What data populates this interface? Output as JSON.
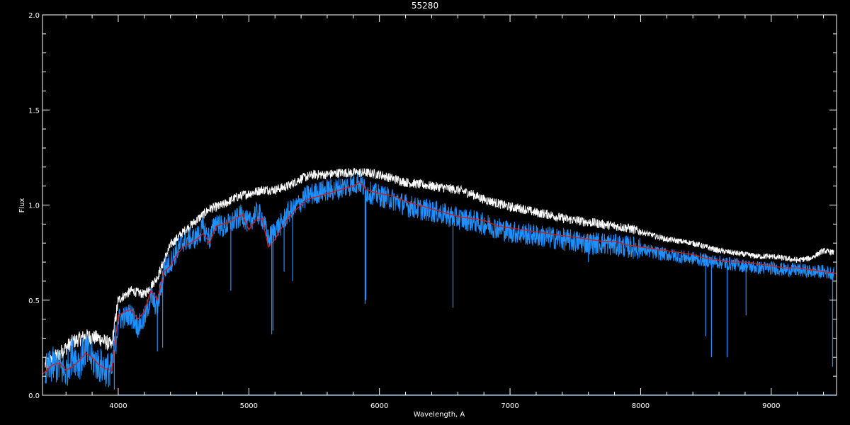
{
  "chart_data": {
    "type": "line",
    "title": "55280",
    "xlabel": "Wavelength, A",
    "ylabel": "Flux",
    "xlim": [
      3420,
      9500
    ],
    "ylim": [
      0.0,
      2.0
    ],
    "x_ticks": [
      4000,
      5000,
      6000,
      7000,
      8000,
      9000
    ],
    "x_tick_labels": [
      "4000",
      "5000",
      "6000",
      "7000",
      "8000",
      "9000"
    ],
    "y_ticks": [
      0.0,
      0.5,
      1.0,
      1.5,
      2.0
    ],
    "y_tick_labels": [
      "0.0",
      "0.5",
      "1.0",
      "1.5",
      "2.0"
    ],
    "background": "#000000",
    "axis_color": "#ffffff",
    "series": [
      {
        "role": "upper-envelope",
        "color": "#ffffff",
        "x": [
          3440,
          3550,
          3650,
          3750,
          3850,
          3950,
          4000,
          4100,
          4200,
          4300,
          4400,
          4500,
          4600,
          4700,
          4800,
          4900,
          5000,
          5100,
          5200,
          5300,
          5400,
          5500,
          5600,
          5700,
          5800,
          5900,
          6000,
          6100,
          6200,
          6300,
          6400,
          6500,
          6600,
          6700,
          6800,
          6900,
          7000,
          7100,
          7200,
          7300,
          7400,
          7500,
          7600,
          7700,
          7800,
          7900,
          8000,
          8100,
          8200,
          8300,
          8400,
          8500,
          8600,
          8700,
          8800,
          8900,
          9000,
          9100,
          9200,
          9300,
          9400,
          9480
        ],
        "y": [
          0.16,
          0.22,
          0.28,
          0.31,
          0.3,
          0.26,
          0.5,
          0.55,
          0.53,
          0.62,
          0.79,
          0.86,
          0.92,
          0.98,
          1.0,
          1.04,
          1.06,
          1.08,
          1.08,
          1.1,
          1.14,
          1.16,
          1.16,
          1.17,
          1.17,
          1.17,
          1.16,
          1.14,
          1.12,
          1.11,
          1.1,
          1.09,
          1.08,
          1.06,
          1.03,
          1.01,
          0.99,
          0.98,
          0.96,
          0.95,
          0.93,
          0.92,
          0.91,
          0.9,
          0.89,
          0.88,
          0.86,
          0.84,
          0.82,
          0.81,
          0.8,
          0.78,
          0.76,
          0.75,
          0.74,
          0.73,
          0.73,
          0.72,
          0.71,
          0.72,
          0.76,
          0.75
        ]
      },
      {
        "role": "observed-spectrum",
        "color": "#1e90ff",
        "x": [
          3440,
          3500,
          3550,
          3600,
          3650,
          3700,
          3750,
          3800,
          3850,
          3900,
          3950,
          4000,
          4050,
          4100,
          4150,
          4200,
          4250,
          4300,
          4350,
          4400,
          4450,
          4500,
          4550,
          4600,
          4650,
          4700,
          4750,
          4800,
          4850,
          4900,
          4950,
          5000,
          5050,
          5100,
          5150,
          5200,
          5250,
          5300,
          5350,
          5400,
          5450,
          5500,
          5550,
          5600,
          5650,
          5700,
          5750,
          5800,
          5850,
          5900,
          5950,
          6000,
          6100,
          6200,
          6300,
          6400,
          6500,
          6600,
          6700,
          6800,
          6900,
          7000,
          7100,
          7200,
          7300,
          7400,
          7500,
          7600,
          7700,
          7800,
          7900,
          8000,
          8100,
          8200,
          8300,
          8400,
          8500,
          8600,
          8700,
          8800,
          8900,
          9000,
          9100,
          9200,
          9300,
          9400,
          9480
        ],
        "y": [
          0.12,
          0.16,
          0.15,
          0.12,
          0.22,
          0.17,
          0.24,
          0.19,
          0.16,
          0.14,
          0.13,
          0.4,
          0.41,
          0.43,
          0.36,
          0.4,
          0.52,
          0.46,
          0.66,
          0.7,
          0.76,
          0.81,
          0.82,
          0.83,
          0.88,
          0.82,
          0.92,
          0.88,
          0.9,
          0.92,
          0.95,
          0.9,
          0.96,
          0.94,
          0.82,
          0.87,
          0.9,
          0.96,
          0.98,
          1.02,
          1.05,
          1.06,
          1.07,
          1.08,
          1.08,
          1.09,
          1.1,
          1.11,
          1.12,
          1.07,
          1.06,
          1.05,
          1.03,
          1.0,
          0.98,
          0.97,
          0.95,
          0.93,
          0.92,
          0.9,
          0.88,
          0.86,
          0.85,
          0.84,
          0.83,
          0.82,
          0.81,
          0.8,
          0.8,
          0.79,
          0.78,
          0.77,
          0.75,
          0.74,
          0.73,
          0.72,
          0.71,
          0.7,
          0.69,
          0.68,
          0.67,
          0.67,
          0.66,
          0.66,
          0.65,
          0.65,
          0.64
        ]
      },
      {
        "role": "model-fit",
        "color": "#d01c1c",
        "x": [
          3420,
          3450,
          3500,
          3550,
          3600,
          3650,
          3700,
          3750,
          3800,
          3850,
          3900,
          3950,
          4000,
          4050,
          4100,
          4150,
          4200,
          4250,
          4300,
          4350,
          4400,
          4450,
          4500,
          4550,
          4600,
          4650,
          4700,
          4750,
          4800,
          4850,
          4900,
          4950,
          5000,
          5050,
          5100,
          5150,
          5200,
          5250,
          5300,
          5350,
          5400,
          5450,
          5500,
          5550,
          5600,
          5650,
          5700,
          5750,
          5800,
          5850,
          5900,
          5950,
          6000,
          6100,
          6200,
          6300,
          6400,
          6500,
          6600,
          6700,
          6800,
          6900,
          7000,
          7100,
          7200,
          7300,
          7400,
          7500,
          7600,
          7700,
          7800,
          7900,
          8000,
          8100,
          8200,
          8300,
          8400,
          8500,
          8600,
          8700,
          8800,
          8900,
          9000,
          9100,
          9200,
          9300,
          9400,
          9500
        ],
        "y": [
          0.11,
          0.13,
          0.16,
          0.17,
          0.13,
          0.15,
          0.18,
          0.22,
          0.2,
          0.16,
          0.14,
          0.13,
          0.42,
          0.44,
          0.45,
          0.4,
          0.44,
          0.55,
          0.5,
          0.65,
          0.68,
          0.74,
          0.78,
          0.8,
          0.82,
          0.85,
          0.8,
          0.89,
          0.9,
          0.91,
          0.93,
          0.95,
          0.87,
          0.92,
          0.93,
          0.78,
          0.82,
          0.88,
          0.93,
          0.97,
          1.0,
          1.03,
          1.04,
          1.05,
          1.06,
          1.07,
          1.08,
          1.09,
          1.1,
          1.12,
          1.08,
          1.07,
          1.06,
          1.05,
          1.02,
          1.0,
          0.98,
          0.96,
          0.94,
          0.93,
          0.92,
          0.89,
          0.88,
          0.87,
          0.86,
          0.85,
          0.84,
          0.83,
          0.82,
          0.81,
          0.81,
          0.79,
          0.78,
          0.77,
          0.76,
          0.75,
          0.74,
          0.72,
          0.71,
          0.7,
          0.7,
          0.69,
          0.68,
          0.67,
          0.67,
          0.66,
          0.65,
          0.64
        ]
      }
    ],
    "absorption_lines": [
      {
        "x": 3935,
        "y_min": 0.05
      },
      {
        "x": 3970,
        "y_min": 0.03
      },
      {
        "x": 4105,
        "y_min": 0.35
      },
      {
        "x": 4300,
        "y_min": 0.23
      },
      {
        "x": 4340,
        "y_min": 0.25
      },
      {
        "x": 4862,
        "y_min": 0.55
      },
      {
        "x": 5175,
        "y_min": 0.32
      },
      {
        "x": 5185,
        "y_min": 0.34
      },
      {
        "x": 5270,
        "y_min": 0.65
      },
      {
        "x": 5335,
        "y_min": 0.6
      },
      {
        "x": 5890,
        "y_min": 0.48
      },
      {
        "x": 5896,
        "y_min": 0.5
      },
      {
        "x": 6563,
        "y_min": 0.46
      },
      {
        "x": 7600,
        "y_min": 0.7
      },
      {
        "x": 8498,
        "y_min": 0.31
      },
      {
        "x": 8542,
        "y_min": 0.2
      },
      {
        "x": 8662,
        "y_min": 0.2
      },
      {
        "x": 8807,
        "y_min": 0.42
      },
      {
        "x": 9470,
        "y_min": 0.15
      }
    ]
  }
}
